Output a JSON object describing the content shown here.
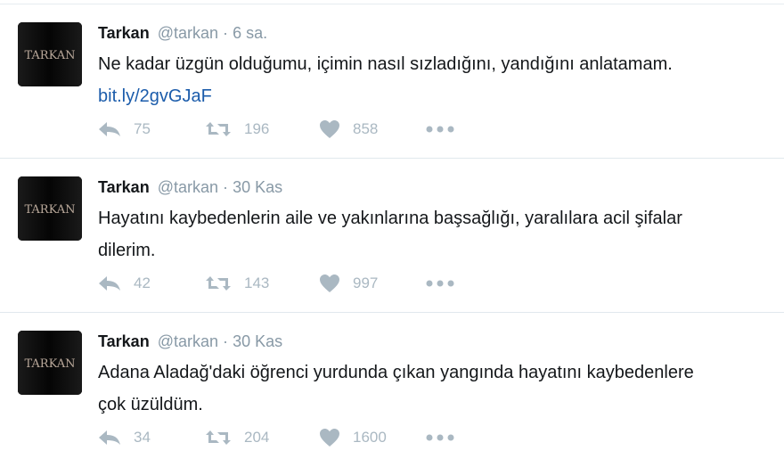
{
  "tweets": [
    {
      "name": "Tarkan",
      "handle": "@tarkan",
      "separator": "·",
      "time": "6 sa.",
      "text": "Ne kadar üzgün olduğumu, içimin nasıl sızladığını, yandığını anlatamam. ",
      "link": "bit.ly/2gvGJaF",
      "avatar_text": "TARKAN",
      "replies": "75",
      "retweets": "196",
      "likes": "858"
    },
    {
      "name": "Tarkan",
      "handle": "@tarkan",
      "separator": "·",
      "time": "30 Kas",
      "text": "Hayatını kaybedenlerin aile ve yakınlarına başsağlığı, yaralılara acil şifalar dilerim.",
      "link": "",
      "avatar_text": "TARKAN",
      "replies": "42",
      "retweets": "143",
      "likes": "997"
    },
    {
      "name": "Tarkan",
      "handle": "@tarkan",
      "separator": "·",
      "time": "30 Kas",
      "text": "Adana Aladağ'daki öğrenci yurdunda çıkan yangında hayatını kaybedenlere çok üzüldüm.",
      "link": "",
      "avatar_text": "TARKAN",
      "replies": "34",
      "retweets": "204",
      "likes": "1600"
    }
  ],
  "icons": {
    "reply": "reply-icon",
    "retweet": "retweet-icon",
    "like": "heart-icon",
    "more": "more-icon"
  },
  "colors": {
    "link": "#1b5cab",
    "meta": "#8899a6",
    "action": "#aab8c2",
    "divider": "#e1e8ed"
  }
}
